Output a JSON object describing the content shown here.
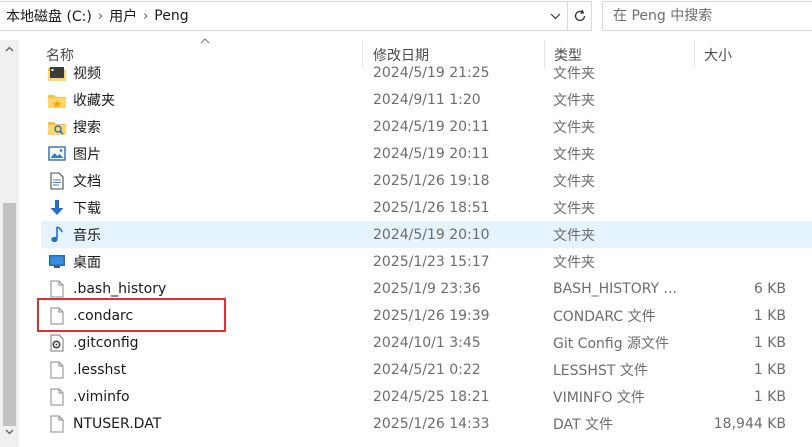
{
  "address": {
    "crumbs": [
      "本地磁盘 (C:)",
      "用户",
      "Peng"
    ]
  },
  "search": {
    "placeholder": "在 Peng 中搜索"
  },
  "columns": {
    "name": "名称",
    "date": "修改日期",
    "type": "类型",
    "size": "大小"
  },
  "files": [
    {
      "name": "视频",
      "date": "2024/5/19 21:25",
      "type": "文件夹",
      "size": "",
      "icon": "video-folder-icon"
    },
    {
      "name": "收藏夹",
      "date": "2024/9/11 1:20",
      "type": "文件夹",
      "size": "",
      "icon": "favorites-folder-icon"
    },
    {
      "name": "搜索",
      "date": "2024/5/19 20:11",
      "type": "文件夹",
      "size": "",
      "icon": "search-folder-icon"
    },
    {
      "name": "图片",
      "date": "2024/5/19 20:11",
      "type": "文件夹",
      "size": "",
      "icon": "pictures-folder-icon"
    },
    {
      "name": "文档",
      "date": "2025/1/26 19:18",
      "type": "文件夹",
      "size": "",
      "icon": "documents-folder-icon"
    },
    {
      "name": "下载",
      "date": "2025/1/26 18:51",
      "type": "文件夹",
      "size": "",
      "icon": "downloads-folder-icon"
    },
    {
      "name": "音乐",
      "date": "2024/5/19 20:10",
      "type": "文件夹",
      "size": "",
      "icon": "music-folder-icon"
    },
    {
      "name": "桌面",
      "date": "2025/1/23 15:17",
      "type": "文件夹",
      "size": "",
      "icon": "desktop-folder-icon"
    },
    {
      "name": ".bash_history",
      "date": "2025/1/9 23:36",
      "type": "BASH_HISTORY ...",
      "size": "6 KB",
      "icon": "file-icon"
    },
    {
      "name": ".condarc",
      "date": "2025/1/26 19:39",
      "type": "CONDARC 文件",
      "size": "1 KB",
      "icon": "file-icon"
    },
    {
      "name": ".gitconfig",
      "date": "2024/10/1 3:45",
      "type": "Git Config 源文件",
      "size": "1 KB",
      "icon": "config-file-icon"
    },
    {
      "name": ".lesshst",
      "date": "2024/5/21 0:22",
      "type": "LESSHST 文件",
      "size": "1 KB",
      "icon": "file-icon"
    },
    {
      "name": ".viminfo",
      "date": "2024/5/25 18:21",
      "type": "VIMINFO 文件",
      "size": "1 KB",
      "icon": "file-icon"
    },
    {
      "name": "NTUSER.DAT",
      "date": "2025/1/26 14:33",
      "type": "DAT 文件",
      "size": "18,944 KB",
      "icon": "file-icon"
    }
  ],
  "selected_index": 6,
  "highlighted_index": 9,
  "colors": {
    "selected_row": "#e5f3ff",
    "highlight_border": "#e0312c",
    "folder": "#f4c04a"
  }
}
